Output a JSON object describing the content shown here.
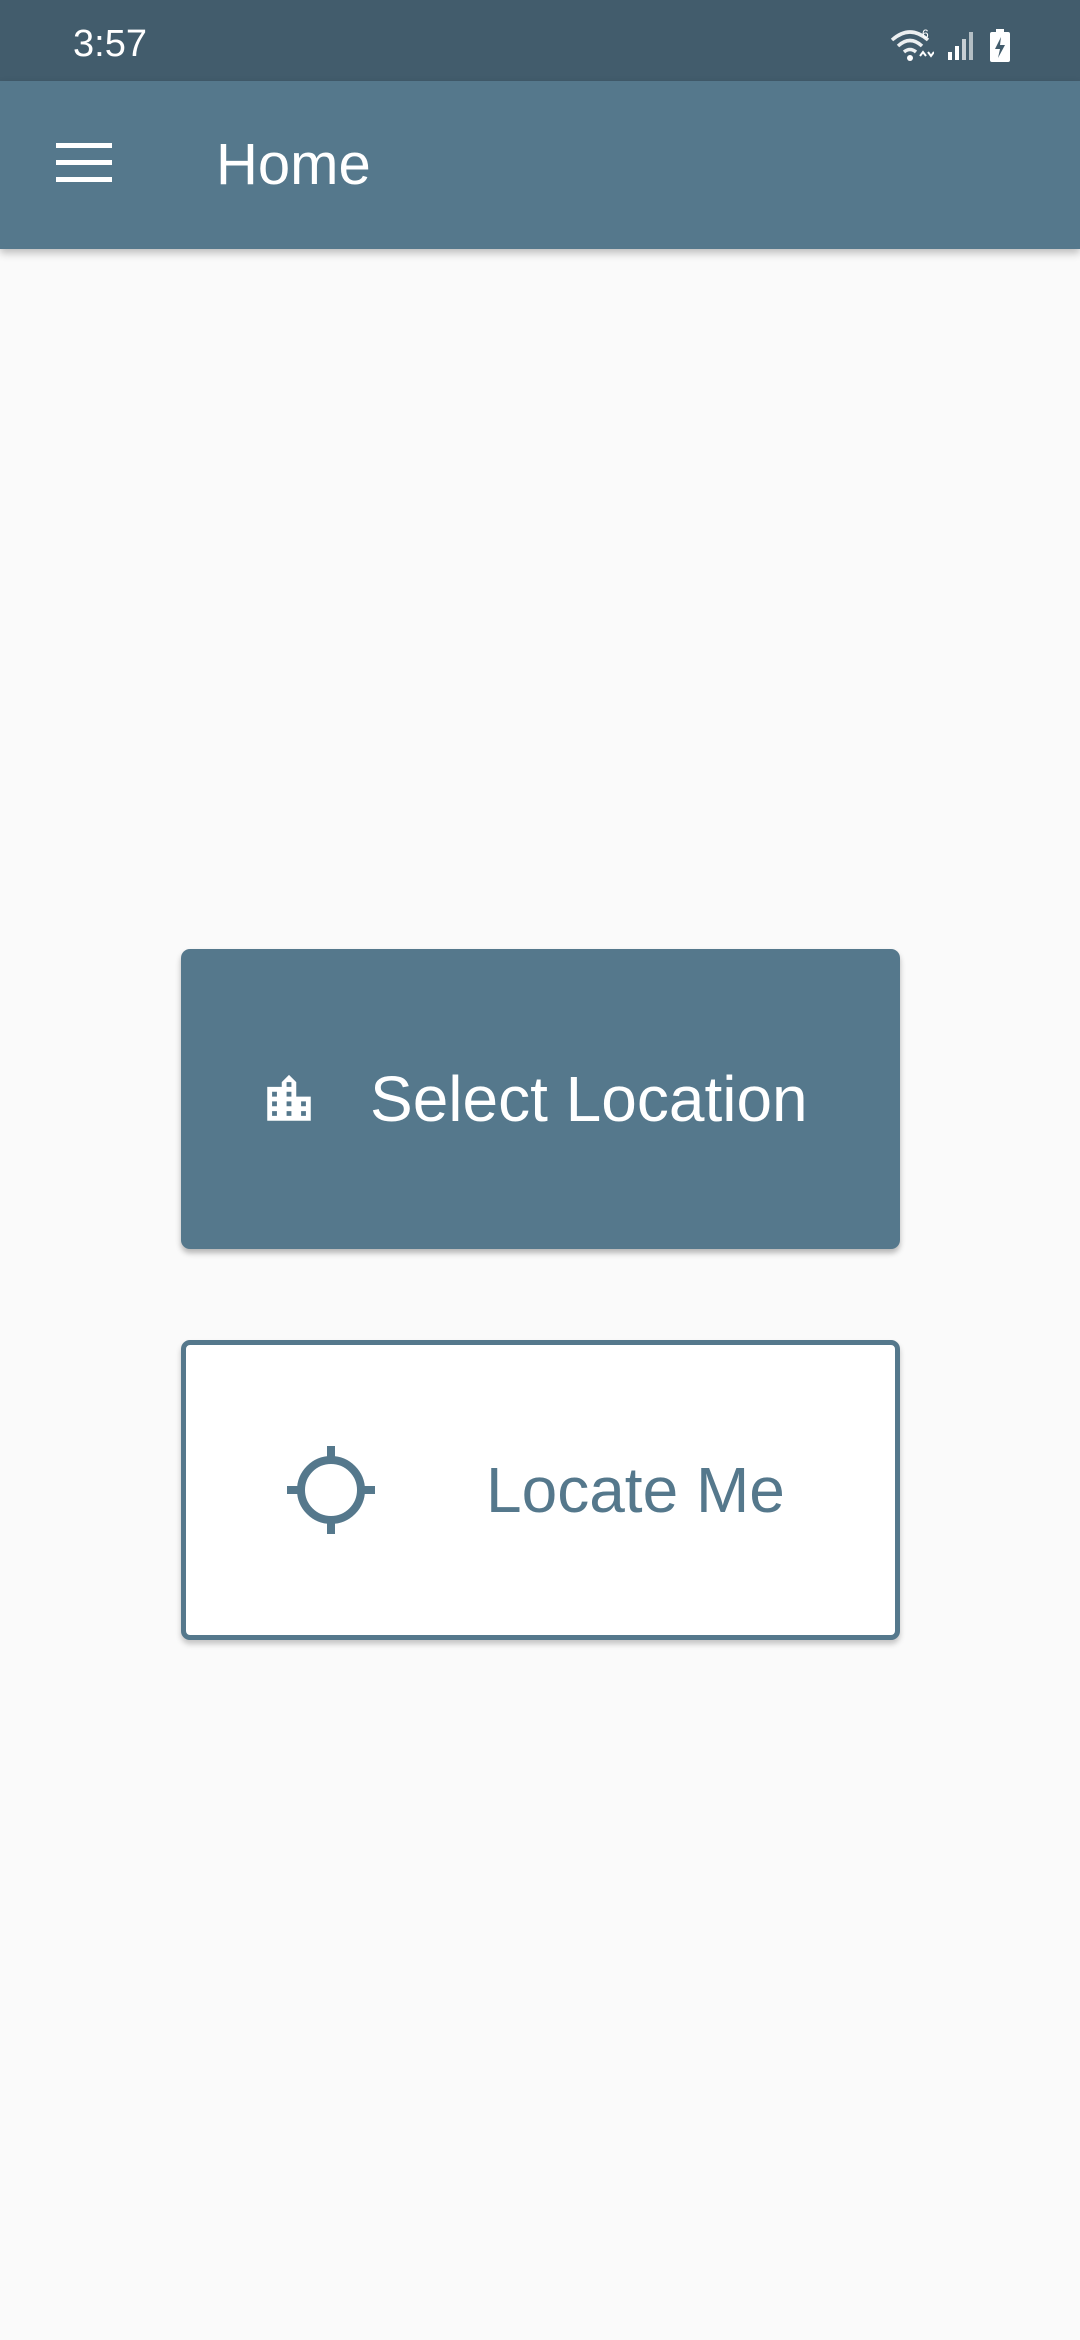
{
  "status_bar": {
    "time": "3:57",
    "icons": [
      "wifi-icon",
      "cell-signal-icon",
      "battery-charging-icon"
    ],
    "wifi_badge": "6"
  },
  "app_bar": {
    "menu_icon": "hamburger-menu-icon",
    "title": "Home"
  },
  "actions": {
    "select_location": {
      "label": "Select Location",
      "icon": "city-building-icon"
    },
    "locate_me": {
      "label": "Locate Me",
      "icon": "crosshair-target-icon"
    }
  },
  "colors": {
    "status_bar": "#425c6c",
    "primary": "#55788c",
    "background": "#fafafa",
    "on_primary": "#ffffff"
  }
}
